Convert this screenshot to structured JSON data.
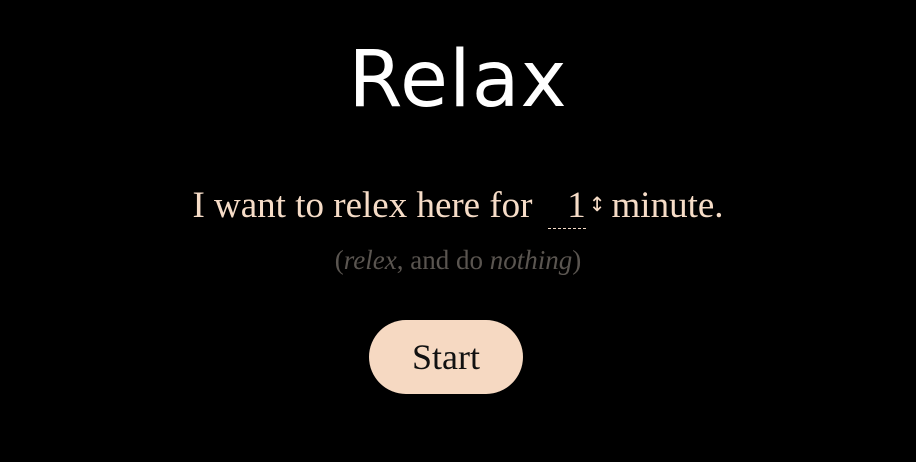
{
  "app": {
    "title": "Relax"
  },
  "prompt": {
    "prefix": "I want to relex here for",
    "minutes_value": "1",
    "suffix": "minute."
  },
  "subtitle": {
    "open_paren": "(",
    "word1": "relex",
    "middle": ", and do ",
    "word2": "nothing",
    "close_paren": ")"
  },
  "actions": {
    "start_label": "Start"
  },
  "icons": {
    "spinner": "up-down-arrow-icon"
  },
  "colors": {
    "background": "#000000",
    "title": "#ffffff",
    "text": "#f6dcc7",
    "muted": "#5a5550",
    "button_bg": "#f6d9c2",
    "button_text": "#111111"
  }
}
